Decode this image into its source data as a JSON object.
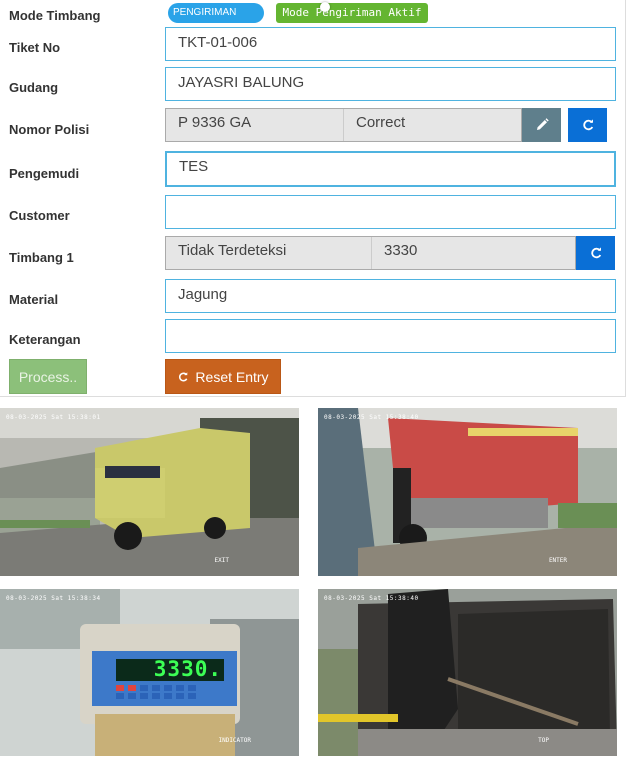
{
  "form": {
    "mode_label": "Mode Timbang",
    "mode_pill": "PENGIRIMAN",
    "mode_active": "Mode Pengiriman Aktif",
    "tiket_label": "Tiket No",
    "tiket_value": "TKT-01-006",
    "gudang_label": "Gudang",
    "gudang_value": "JAYASRI BALUNG",
    "nopol_label": "Nomor Polisi",
    "nopol_value": "P 9336 GA",
    "nopol_status": "Correct",
    "pengemudi_label": "Pengemudi",
    "pengemudi_value": "TES",
    "customer_label": "Customer",
    "customer_value": "",
    "timbang_label": "Timbang 1",
    "timbang_status": "Tidak Terdeteksi",
    "timbang_value": "3330",
    "material_label": "Material",
    "material_value": "Jagung",
    "keterangan_label": "Keterangan",
    "keterangan_value": "",
    "process_label": "Process..",
    "reset_label": "Reset Entry"
  },
  "cameras": [
    {
      "timestamp": "08-03-2025 Sat 15:38:01",
      "label": "EXIT"
    },
    {
      "timestamp": "08-03-2025 Sat 15:38:40",
      "label": "ENTER"
    },
    {
      "timestamp": "08-03-2025 Sat 15:38:34",
      "label": "INDICATOR",
      "display": "3330."
    },
    {
      "timestamp": "08-03-2025 Sat 15:38:40",
      "label": "TOP"
    }
  ],
  "colors": {
    "accent_border": "#4fb3e0",
    "blue_button": "#0a6fd6",
    "edit_button": "#5f7f8c",
    "process_button": "#8cc07a",
    "reset_button": "#c8621e"
  }
}
